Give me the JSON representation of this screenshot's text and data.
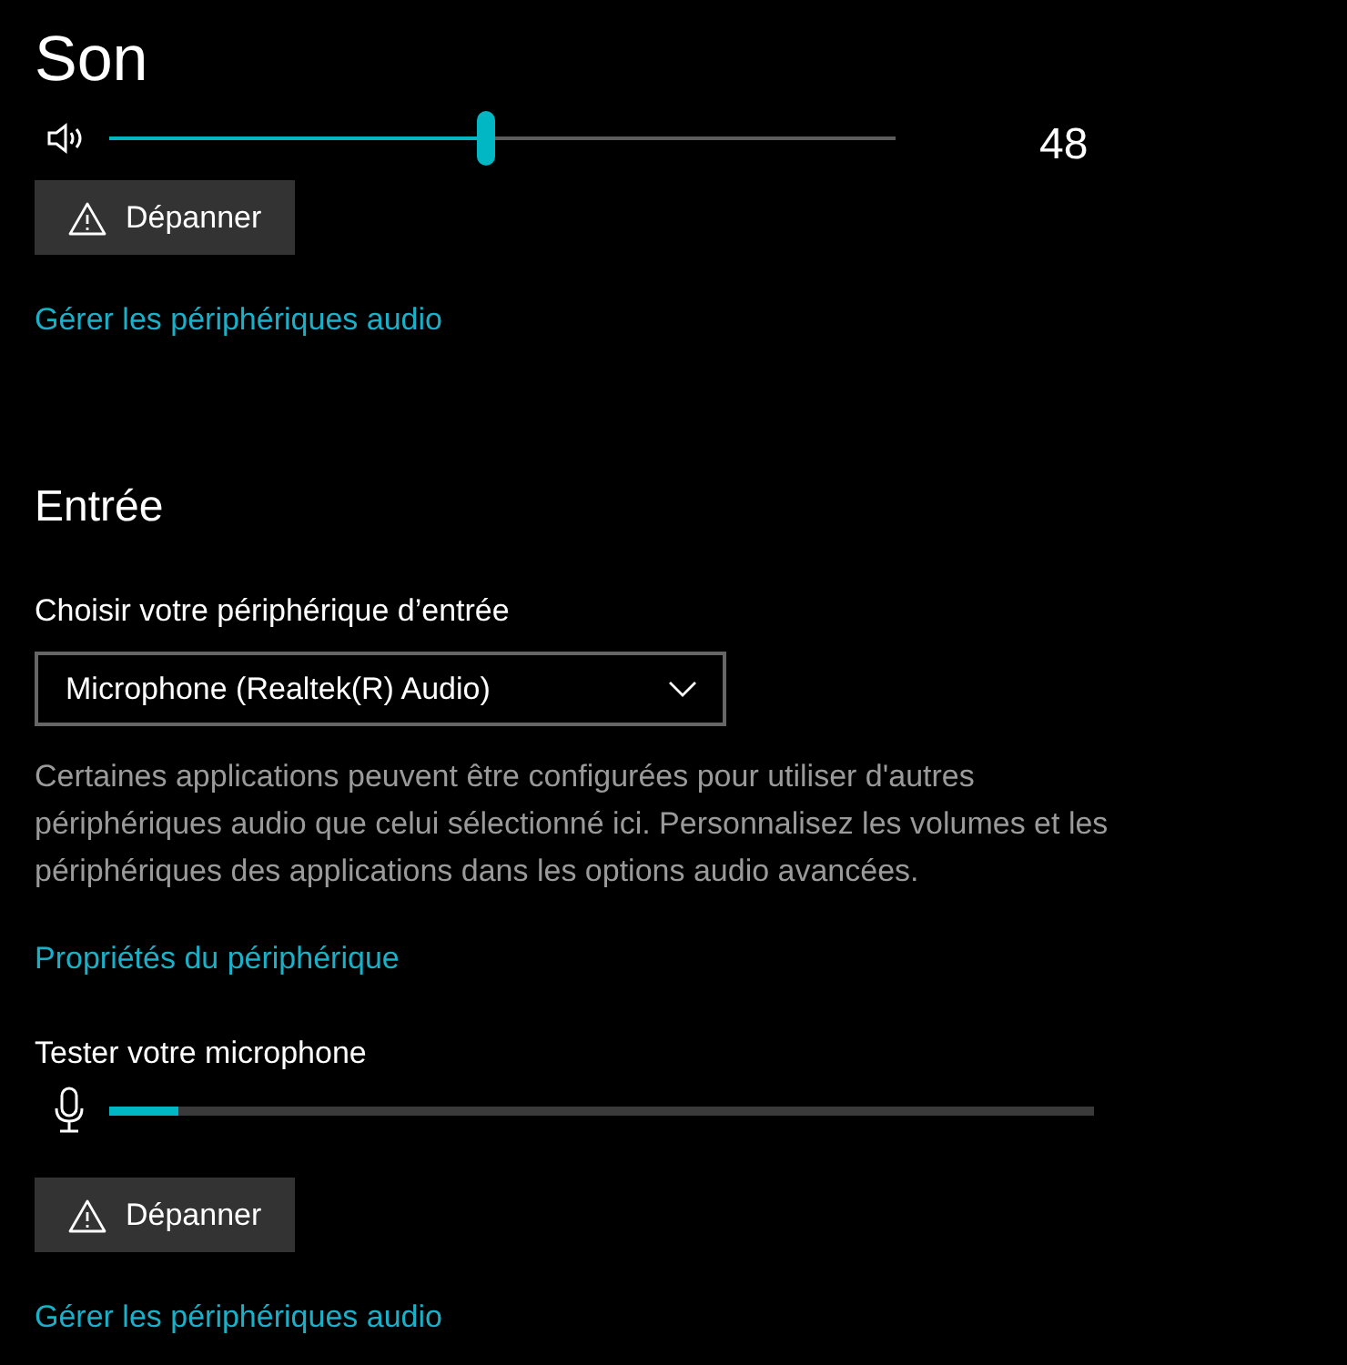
{
  "output": {
    "title": "Son",
    "volume": {
      "level": 0.48,
      "reading": "48"
    },
    "troubleshoot_button": "Dépanner",
    "manage_link": "Gérer les périphériques audio"
  },
  "input": {
    "title": "Entrée",
    "device_label": "Choisir votre périphérique d’entrée",
    "device_value": "Microphone (Realtek(R) Audio)",
    "description": "Certaines applications peuvent être configurées pour utiliser d'autres périphériques audio que celui sélectionné ici. Personnalisez les volumes et les périphériques des applications dans les options audio avancées.",
    "properties_link": "Propriétés du périphérique",
    "test_label": "Tester votre microphone",
    "mic_meter": {
      "level": 0.07
    },
    "troubleshoot_button": "Dépanner",
    "manage_link": "Gérer les périphériques audio"
  }
}
